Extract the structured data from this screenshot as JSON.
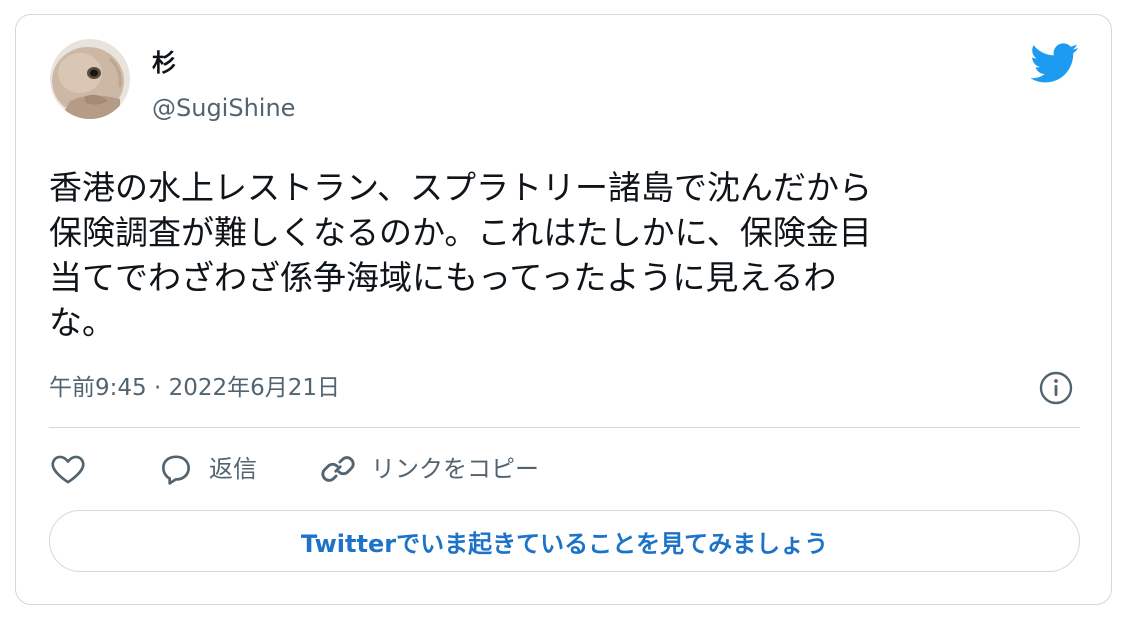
{
  "user": {
    "display_name": "杉",
    "handle": "@SugiShine"
  },
  "tweet": {
    "text": "香港の水上レストラン、スプラトリー諸島で沈んだから\n保険調査が難しくなるのか。これはたしかに、保険金目\n当てでわざわざ係争海域にもってったように見えるわ\nな。",
    "timestamp": "午前9:45 · 2022年6月21日"
  },
  "actions": {
    "reply_label": "返信",
    "copy_link_label": "リンクをコピー"
  },
  "cta": {
    "label": "Twitterでいま起きていることを見てみましょう"
  },
  "icons": {
    "logo": "twitter-bird-icon",
    "info": "info-icon",
    "like": "heart-icon",
    "reply": "speech-bubble-icon",
    "link": "link-icon"
  },
  "colors": {
    "brand": "#1d9bf0",
    "cta_text": "#1d73c8",
    "text_primary": "#0f1419",
    "text_secondary": "#536471",
    "border": "#cfd9de"
  }
}
